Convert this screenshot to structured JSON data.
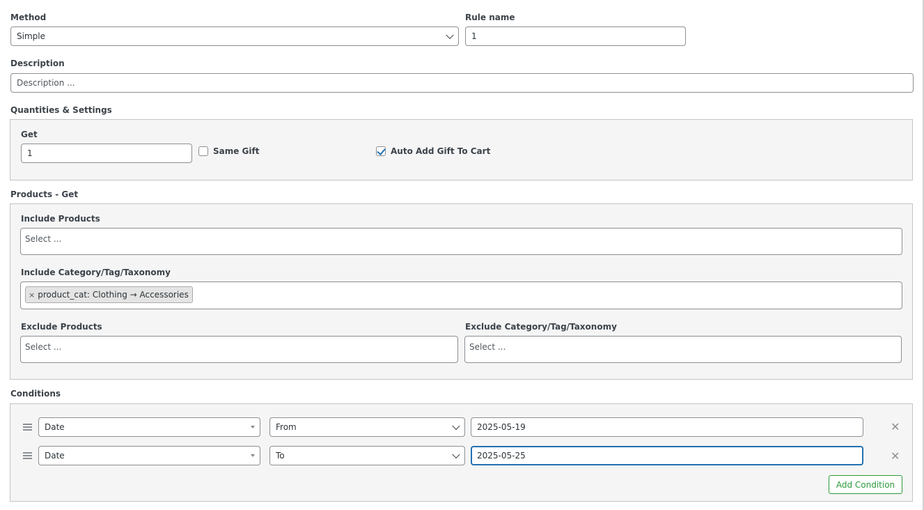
{
  "rule": {
    "method_label": "Method",
    "method_value": "Simple",
    "rule_name_label": "Rule name",
    "rule_name_value": "1",
    "description_label": "Description",
    "description_placeholder": "Description ..."
  },
  "quantities": {
    "section_title": "Quantities & Settings",
    "get_label": "Get",
    "get_value": "1",
    "same_gift_label": "Same Gift",
    "same_gift_checked": false,
    "auto_add_label": "Auto Add Gift To Cart",
    "auto_add_checked": true
  },
  "products_get": {
    "section_title": "Products - Get",
    "include_products_label": "Include Products",
    "include_products_placeholder": "Select ...",
    "include_category_label": "Include Category/Tag/Taxonomy",
    "include_category_tokens": [
      {
        "remove": "×",
        "text": "product_cat: Clothing → Accessories"
      }
    ],
    "exclude_products_label": "Exclude Products",
    "exclude_products_placeholder": "Select ...",
    "exclude_category_label": "Exclude Category/Tag/Taxonomy",
    "exclude_category_placeholder": "Select ..."
  },
  "conditions": {
    "section_title": "Conditions",
    "rows": [
      {
        "type": "Date",
        "operator": "From",
        "value": "2025-05-19",
        "remove": "✕"
      },
      {
        "type": "Date",
        "operator": "To",
        "value": "2025-05-25",
        "remove": "✕"
      }
    ],
    "add_button": "Add Condition"
  },
  "icons": {
    "drag": "drag-handle-icon",
    "remove": "close-icon",
    "chevron": "chevron-down-icon",
    "check": "check-icon"
  },
  "colors": {
    "accent": "#2271b1",
    "add_button": "#2c9a3c",
    "panel_bg": "#f5f5f5"
  }
}
